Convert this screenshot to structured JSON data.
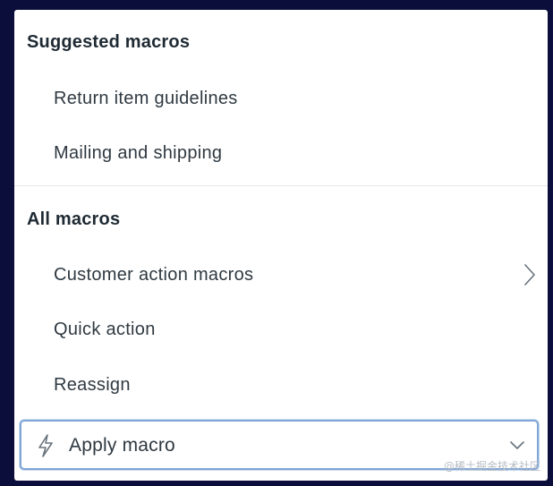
{
  "suggested": {
    "title": "Suggested macros",
    "items": [
      {
        "label": "Return item guidelines"
      },
      {
        "label": "Mailing and shipping"
      }
    ]
  },
  "all": {
    "title": "All macros",
    "items": [
      {
        "label": "Customer action macros",
        "has_submenu": true
      },
      {
        "label": "Quick action"
      },
      {
        "label": "Reassign"
      }
    ]
  },
  "footer": {
    "label": "Apply macro",
    "icon": "lightning-bolt-icon",
    "dropdown_icon": "chevron-down-icon"
  },
  "watermark": "@稀土掘金技术社区",
  "colors": {
    "background": "#0b0d3a",
    "panel": "#ffffff",
    "text": "#2f3941",
    "focus_border": "#7fa6d6"
  }
}
